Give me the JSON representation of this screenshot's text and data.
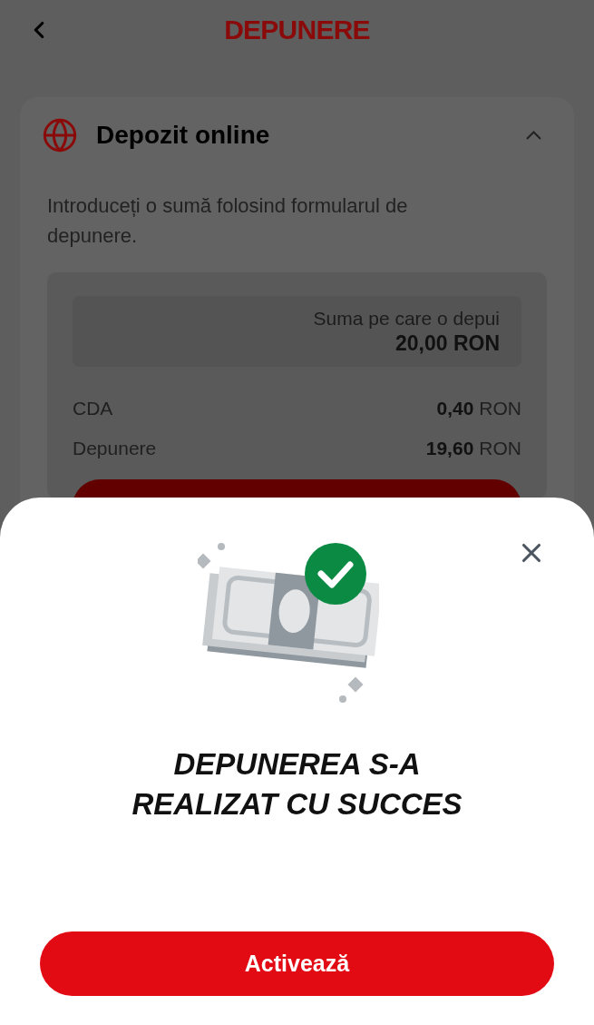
{
  "header": {
    "title": "DEPUNERE"
  },
  "card": {
    "title": "Depozit online",
    "expanded": true,
    "description": "Introduceți o sumă folosind formularul de depunere.",
    "amount_field": {
      "label": "Suma pe care o depui",
      "value": "20,00 RON"
    },
    "summary": [
      {
        "label": "CDA",
        "amount": "0,40",
        "currency": "RON"
      },
      {
        "label": "Depunere",
        "amount": "19,60",
        "currency": "RON"
      }
    ]
  },
  "dialog": {
    "title": "DEPUNEREA S-A REALIZAT CU SUCCES",
    "button": "Activează"
  }
}
